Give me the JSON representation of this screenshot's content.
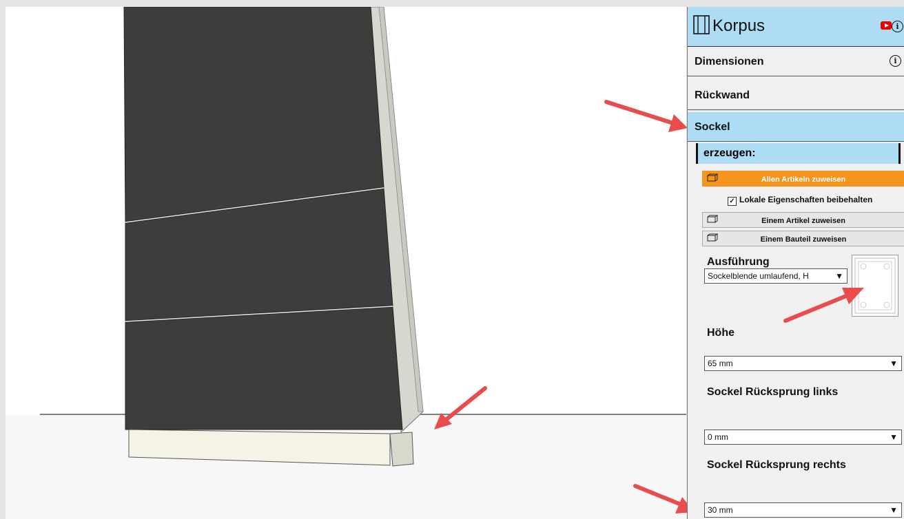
{
  "panel": {
    "title": "Korpus",
    "sections": {
      "dimensionen": "Dimensionen",
      "rueckwand": "Rückwand",
      "sockel": "Sockel"
    },
    "erzeugen": "erzeugen:",
    "buttons": {
      "all": "Allen Artikeln zuweisen",
      "one_article": "Einem Artikel zuweisen",
      "one_part": "Einem Bauteil zuweisen"
    },
    "keep_local": "Lokale Eigenschaften beibehalten",
    "ausfuehrung": {
      "label": "Ausführung",
      "value": "Sockelblende umlaufend, H"
    },
    "hoehe": {
      "label": "Höhe",
      "value": "65 mm"
    },
    "links": {
      "label": "Sockel Rücksprung links",
      "value": "0 mm"
    },
    "rechts": {
      "label": "Sockel Rücksprung rechts",
      "value": "30 mm"
    }
  },
  "icons": [
    "cabinet-icon",
    "youtube-icon",
    "info-icon",
    "box-icon",
    "chevron-down-icon",
    "checkbox-icon"
  ],
  "colors": {
    "header_bg": "#addcf4",
    "active_button": "#f7941d",
    "arrow": "#e84c4c",
    "panel_dark": "#3a3a3a"
  }
}
